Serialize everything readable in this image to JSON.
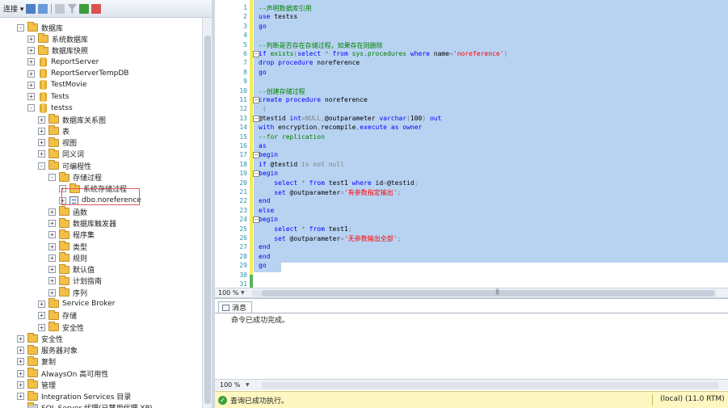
{
  "explorer": {
    "toolbar": {
      "connect_label": "连接 ▾"
    },
    "tree": [
      {
        "label": "数据库",
        "level": 1,
        "exp": "−",
        "icon": "folder"
      },
      {
        "label": "系统数据库",
        "level": 2,
        "exp": "+",
        "icon": "folder"
      },
      {
        "label": "数据库快照",
        "level": 2,
        "exp": "+",
        "icon": "folder"
      },
      {
        "label": "ReportServer",
        "level": 2,
        "exp": "+",
        "icon": "db"
      },
      {
        "label": "ReportServerTempDB",
        "level": 2,
        "exp": "+",
        "icon": "db"
      },
      {
        "label": "TestMovie",
        "level": 2,
        "exp": "+",
        "icon": "db"
      },
      {
        "label": "Tests",
        "level": 2,
        "exp": "+",
        "icon": "db"
      },
      {
        "label": "testss",
        "level": 2,
        "exp": "−",
        "icon": "db"
      },
      {
        "label": "数据库关系图",
        "level": 3,
        "exp": "+",
        "icon": "folder"
      },
      {
        "label": "表",
        "level": 3,
        "exp": "+",
        "icon": "folder"
      },
      {
        "label": "视图",
        "level": 3,
        "exp": "+",
        "icon": "folder"
      },
      {
        "label": "同义词",
        "level": 3,
        "exp": "+",
        "icon": "folder"
      },
      {
        "label": "可编程性",
        "level": 3,
        "exp": "−",
        "icon": "folder"
      },
      {
        "label": "存储过程",
        "level": 4,
        "exp": "−",
        "icon": "folder"
      },
      {
        "label": "系统存储过程",
        "level": 5,
        "exp": "+",
        "icon": "folder"
      },
      {
        "label": "dbo.noreference",
        "level": 5,
        "exp": "+",
        "icon": "sp"
      },
      {
        "label": "函数",
        "level": 4,
        "exp": "+",
        "icon": "folder"
      },
      {
        "label": "数据库触发器",
        "level": 4,
        "exp": "+",
        "icon": "folder"
      },
      {
        "label": "程序集",
        "level": 4,
        "exp": "+",
        "icon": "folder"
      },
      {
        "label": "类型",
        "level": 4,
        "exp": "+",
        "icon": "folder"
      },
      {
        "label": "规则",
        "level": 4,
        "exp": "+",
        "icon": "folder"
      },
      {
        "label": "默认值",
        "level": 4,
        "exp": "+",
        "icon": "folder"
      },
      {
        "label": "计划指南",
        "level": 4,
        "exp": "+",
        "icon": "folder"
      },
      {
        "label": "序列",
        "level": 4,
        "exp": "+",
        "icon": "folder"
      },
      {
        "label": "Service Broker",
        "level": 3,
        "exp": "+",
        "icon": "folder"
      },
      {
        "label": "存储",
        "level": 3,
        "exp": "+",
        "icon": "folder"
      },
      {
        "label": "安全性",
        "level": 3,
        "exp": "+",
        "icon": "folder"
      },
      {
        "label": "安全性",
        "level": 1,
        "exp": "+",
        "icon": "folder"
      },
      {
        "label": "服务器对象",
        "level": 1,
        "exp": "+",
        "icon": "folder"
      },
      {
        "label": "复制",
        "level": 1,
        "exp": "+",
        "icon": "folder"
      },
      {
        "label": "AlwaysOn 高可用性",
        "level": 1,
        "exp": "+",
        "icon": "folder"
      },
      {
        "label": "管理",
        "level": 1,
        "exp": "+",
        "icon": "folder"
      },
      {
        "label": "Integration Services 目录",
        "level": 1,
        "exp": "+",
        "icon": "folder"
      },
      {
        "label": "SQL Server 代理(已禁用代理 XP)",
        "level": 1,
        "exp": "",
        "icon": "agent"
      }
    ]
  },
  "editor": {
    "lines": [
      [
        [
          "cm",
          "--声明数据库引用"
        ]
      ],
      [
        [
          "kw",
          "use "
        ],
        [
          "va",
          "testss"
        ]
      ],
      [
        [
          "kw",
          "go"
        ]
      ],
      [],
      [
        [
          "cm",
          "--判断是否存在存储过程，如果存在则删除"
        ]
      ],
      [
        [
          "kw",
          "if "
        ],
        [
          "sy",
          "exists"
        ],
        [
          "gr",
          "("
        ],
        [
          "kw",
          "select "
        ],
        [
          "gr",
          "* "
        ],
        [
          "kw",
          "from "
        ],
        [
          "sy",
          "sys.procedures "
        ],
        [
          "kw",
          "where "
        ],
        [
          "va",
          "name"
        ],
        [
          "gr",
          "="
        ],
        [
          "st",
          "'noreference'"
        ],
        [
          "gr",
          ")"
        ]
      ],
      [
        [
          "kw",
          "drop procedure "
        ],
        [
          "va",
          "noreference"
        ]
      ],
      [
        [
          "kw",
          "go"
        ]
      ],
      [],
      [
        [
          "cm",
          "--创建存储过程"
        ]
      ],
      [
        [
          "kw",
          "create procedure "
        ],
        [
          "va",
          "noreference"
        ]
      ],
      [
        [
          "gr",
          " ("
        ]
      ],
      [
        [
          "va",
          "@testid "
        ],
        [
          "kw",
          "int"
        ],
        [
          "gr",
          "="
        ],
        [
          "gr",
          "NULL"
        ],
        [
          "gr",
          ","
        ],
        [
          "va",
          "@outparameter "
        ],
        [
          "kw",
          "varchar"
        ],
        [
          "gr",
          "("
        ],
        [
          "va",
          "100"
        ],
        [
          "gr",
          ") "
        ],
        [
          "kw",
          "out"
        ]
      ],
      [
        [
          "kw",
          "with "
        ],
        [
          "va",
          "encryption"
        ],
        [
          "gr",
          ","
        ],
        [
          "va",
          "recompile"
        ],
        [
          "gr",
          ","
        ],
        [
          "kw",
          "execute as owner"
        ]
      ],
      [
        [
          "cm",
          "--for replication"
        ]
      ],
      [
        [
          "kw",
          "as"
        ]
      ],
      [
        [
          "kw",
          "begin"
        ]
      ],
      [
        [
          "kw",
          "if "
        ],
        [
          "va",
          "@testid "
        ],
        [
          "gr",
          "is not null"
        ]
      ],
      [
        [
          "kw",
          "begin"
        ]
      ],
      [
        [
          "va",
          "    "
        ],
        [
          "kw",
          "select "
        ],
        [
          "gr",
          "* "
        ],
        [
          "kw",
          "from "
        ],
        [
          "va",
          "test1 "
        ],
        [
          "kw",
          "where "
        ],
        [
          "va",
          "id"
        ],
        [
          "gr",
          "="
        ],
        [
          "va",
          "@testid"
        ],
        [
          "gr",
          ";"
        ]
      ],
      [
        [
          "va",
          "    "
        ],
        [
          "kw",
          "set "
        ],
        [
          "va",
          "@outparameter"
        ],
        [
          "gr",
          "="
        ],
        [
          "st",
          "'有参数指定输出'"
        ],
        [
          "gr",
          ";"
        ]
      ],
      [
        [
          "kw",
          "end"
        ]
      ],
      [
        [
          "kw",
          "else"
        ]
      ],
      [
        [
          "kw",
          "begin"
        ]
      ],
      [
        [
          "va",
          "    "
        ],
        [
          "kw",
          "select "
        ],
        [
          "gr",
          "* "
        ],
        [
          "kw",
          "from "
        ],
        [
          "va",
          "test1"
        ],
        [
          "gr",
          ";"
        ]
      ],
      [
        [
          "va",
          "    "
        ],
        [
          "kw",
          "set "
        ],
        [
          "va",
          "@outparameter"
        ],
        [
          "gr",
          "="
        ],
        [
          "st",
          "'无参数输出全部'"
        ],
        [
          "gr",
          ";"
        ]
      ],
      [
        [
          "kw",
          "end"
        ]
      ],
      [
        [
          "kw",
          "end"
        ]
      ],
      [
        [
          "kw",
          "go"
        ]
      ],
      [],
      []
    ],
    "zoom_label": "100 %",
    "outline_markers": [
      {
        "line": 6,
        "sign": "−"
      },
      {
        "line": 11,
        "sign": "−"
      },
      {
        "line": 13,
        "sign": "−"
      },
      {
        "line": 17,
        "sign": "−"
      },
      {
        "line": 19,
        "sign": "−"
      },
      {
        "line": 24,
        "sign": "−"
      }
    ]
  },
  "results": {
    "tab_label": "消息",
    "message": "命令已成功完成。",
    "zoom_label": "100 %"
  },
  "status": {
    "text": "查询已成功执行。",
    "server": "(local) (11.0 RTM)"
  },
  "colors": {
    "selection": "#b8d3f2",
    "keyword": "#0000ff",
    "comment": "#008000",
    "string": "#ff0000",
    "status_bg": "#fff7c2"
  }
}
